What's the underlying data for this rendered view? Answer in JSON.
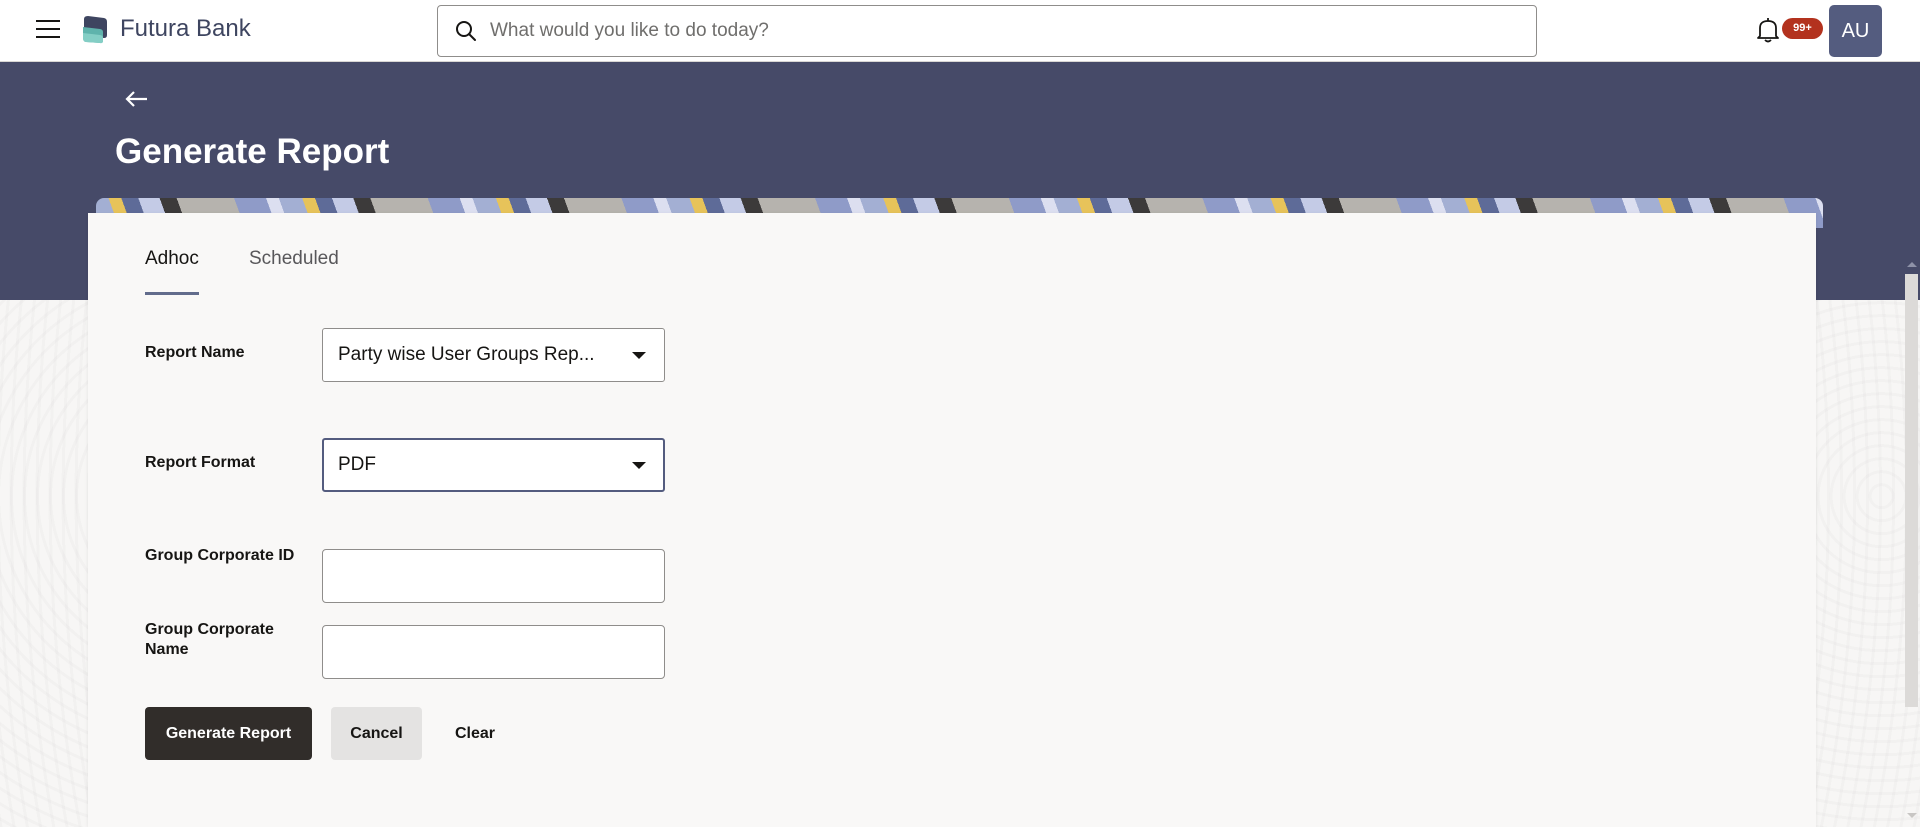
{
  "header": {
    "brand": "Futura Bank",
    "search_placeholder": "What would you like to do today?",
    "notification_count": "99+",
    "avatar_initials": "AU",
    "icons": {
      "menu": "hamburger-menu-icon",
      "logo": "futura-bank-logo-icon",
      "search": "search-icon",
      "notifications": "bell-icon"
    }
  },
  "page": {
    "title": "Generate Report",
    "back_icon": "arrow-left-icon"
  },
  "tabs": [
    {
      "label": "Adhoc",
      "active": true
    },
    {
      "label": "Scheduled",
      "active": false
    }
  ],
  "form": {
    "report_name": {
      "label": "Report Name",
      "value": "Party wise User Groups Rep..."
    },
    "report_format": {
      "label": "Report Format",
      "value": "PDF"
    },
    "group_corporate_id": {
      "label": "Group Corporate ID",
      "value": ""
    },
    "group_corporate_name": {
      "label": "Group Corporate Name",
      "value": ""
    }
  },
  "actions": {
    "generate": "Generate Report",
    "cancel": "Cancel",
    "clear": "Clear"
  },
  "colors": {
    "hero_background": "#464a68",
    "primary_button": "#312d2a",
    "badge": "#b3321e",
    "avatar": "#545c7f",
    "tab_underline": "#626c8c"
  }
}
